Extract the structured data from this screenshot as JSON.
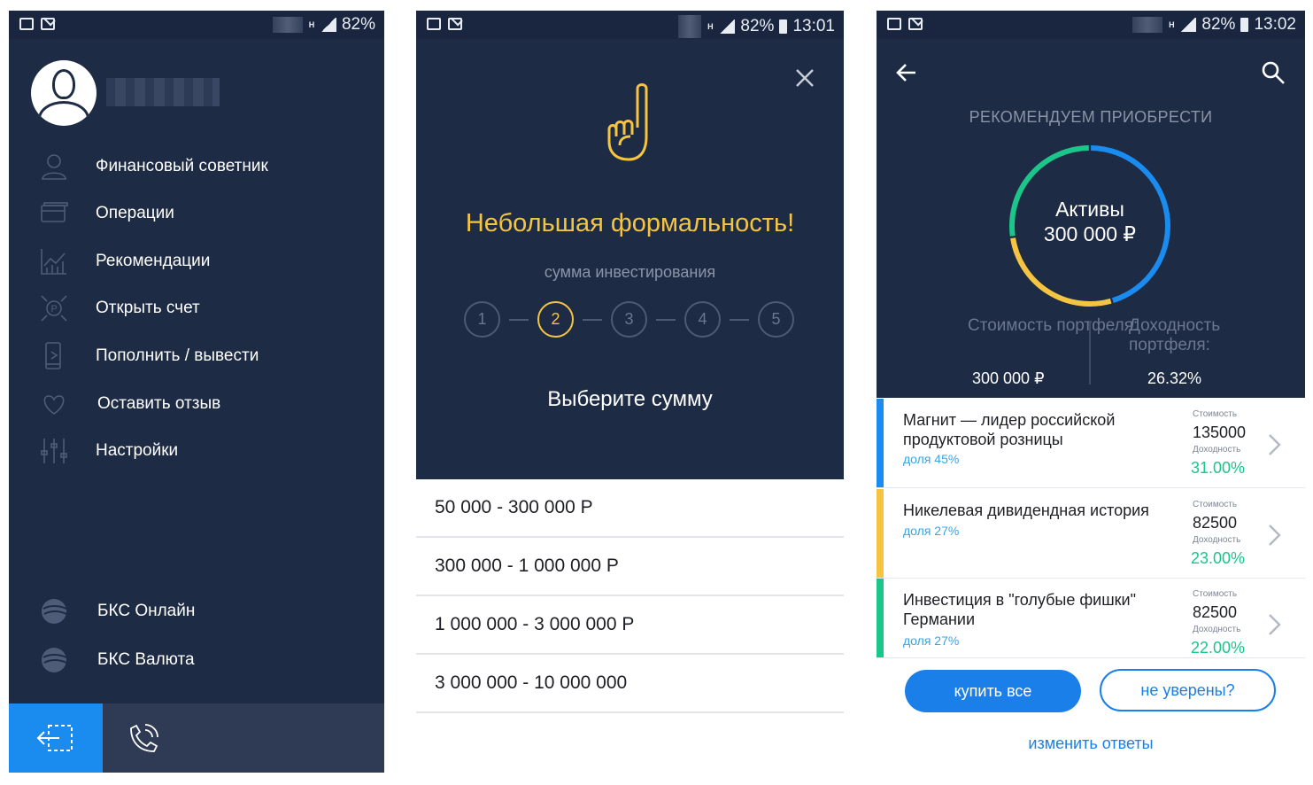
{
  "status": {
    "s1": {
      "battery": "82%",
      "time": ""
    },
    "s2": {
      "battery": "82%",
      "time": "13:01"
    },
    "s3": {
      "battery": "82%",
      "time": "13:02"
    },
    "network": "H"
  },
  "menu": {
    "items": [
      {
        "label": "Финансовый советник",
        "icon": "advisor-icon"
      },
      {
        "label": "Операции",
        "icon": "card-icon"
      },
      {
        "label": "Рекомендации",
        "icon": "chart-icon"
      },
      {
        "label": "Открыть счет",
        "icon": "open-account-icon"
      },
      {
        "label": "Пополнить / вывести",
        "icon": "phone-transfer-icon"
      },
      {
        "label": "Оставить отзыв",
        "icon": "heart-icon"
      },
      {
        "label": "Настройки",
        "icon": "sliders-icon"
      }
    ],
    "apps": [
      {
        "label": "БКС Онлайн",
        "icon": "bcs-logo-icon"
      },
      {
        "label": "БКС Валюта",
        "icon": "bcs-logo-icon"
      }
    ],
    "accent": "#1a8cf0",
    "background": "#1e2b45"
  },
  "wizard": {
    "title": "Небольшая формальность!",
    "subtitle": "сумма инвестирования",
    "steps": [
      "1",
      "2",
      "3",
      "4",
      "5"
    ],
    "active_step": 2,
    "prompt": "Выберите сумму",
    "options": [
      "50 000 - 300 000 Р",
      "300 000 - 1 000 000 Р",
      "1 000 000 - 3 000 000 Р",
      "3 000 000 - 10 000 000"
    ],
    "accent": "#f5c542"
  },
  "recommend": {
    "header": "РЕКОМЕНДУЕМ ПРИОБРЕСТИ",
    "donut_label": "Активы",
    "donut_value": "300 000 ₽",
    "donut_segments": [
      {
        "color": "#1a8cf0",
        "share": 0.45
      },
      {
        "color": "#f5c542",
        "share": 0.27
      },
      {
        "color": "#1cc58a",
        "share": 0.27
      }
    ],
    "cost_label": "Стоимость портфеля:",
    "cost_value": "300 000 ₽",
    "yield_label": "Доходность портфеля:",
    "yield_value": "26.32%",
    "small_cost": "Стоимость",
    "small_yield": "Доходность",
    "rows": [
      {
        "title": "Магнит — лидер российской продуктовой розницы",
        "share": "доля 45%",
        "cost": "135000",
        "yield": "31.00%",
        "color": "#1a8cf0"
      },
      {
        "title": "Никелевая дивидендная история",
        "share": "доля 27%",
        "cost": "82500",
        "yield": "23.00%",
        "color": "#f5c542"
      },
      {
        "title": "Инвестиция в \"голубые фишки\" Германии",
        "share": "доля 27%",
        "cost": "82500",
        "yield": "22.00%",
        "color": "#1cc58a"
      }
    ],
    "buy_all": "купить все",
    "not_sure": "не уверены?",
    "change_answers": "изменить ответы"
  }
}
